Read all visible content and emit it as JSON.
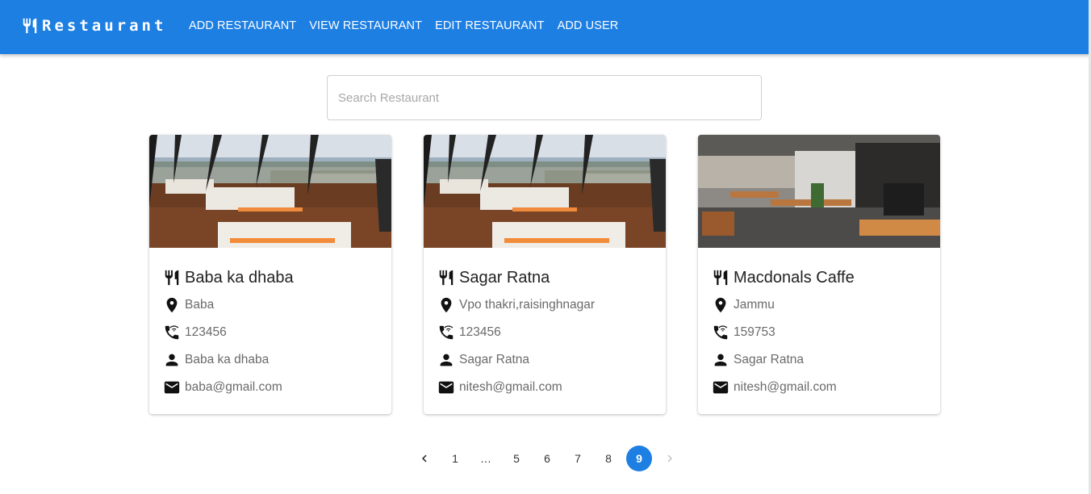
{
  "app": {
    "brand": "Restaurant"
  },
  "nav": [
    "ADD RESTAURANT",
    "VIEW RESTAURANT",
    "EDIT RESTAURANT",
    "ADD USER"
  ],
  "search": {
    "placeholder": "Search Restaurant",
    "value": ""
  },
  "cards": [
    {
      "name": "Baba ka dhaba",
      "address": "Baba",
      "phone": "123456",
      "owner": "Baba ka dhaba",
      "email": "baba@gmail.com",
      "image": "panoramic-restaurant-view"
    },
    {
      "name": "Sagar Ratna",
      "address": "Vpo thakri,raisinghnagar",
      "phone": "123456",
      "owner": "Sagar Ratna",
      "email": "nitesh@gmail.com",
      "image": "panoramic-restaurant-view"
    },
    {
      "name": "Macdonals Caffe",
      "address": "Jammu",
      "phone": "159753",
      "owner": "Sagar Ratna",
      "email": "nitesh@gmail.com",
      "image": "modern-cafe-interior"
    }
  ],
  "pagination": {
    "pages": [
      "1",
      "…",
      "5",
      "6",
      "7",
      "8",
      "9"
    ],
    "current": "9"
  },
  "colors": {
    "primary": "#1e7fe3",
    "text": "#222222",
    "muted": "#6a6a6a"
  }
}
